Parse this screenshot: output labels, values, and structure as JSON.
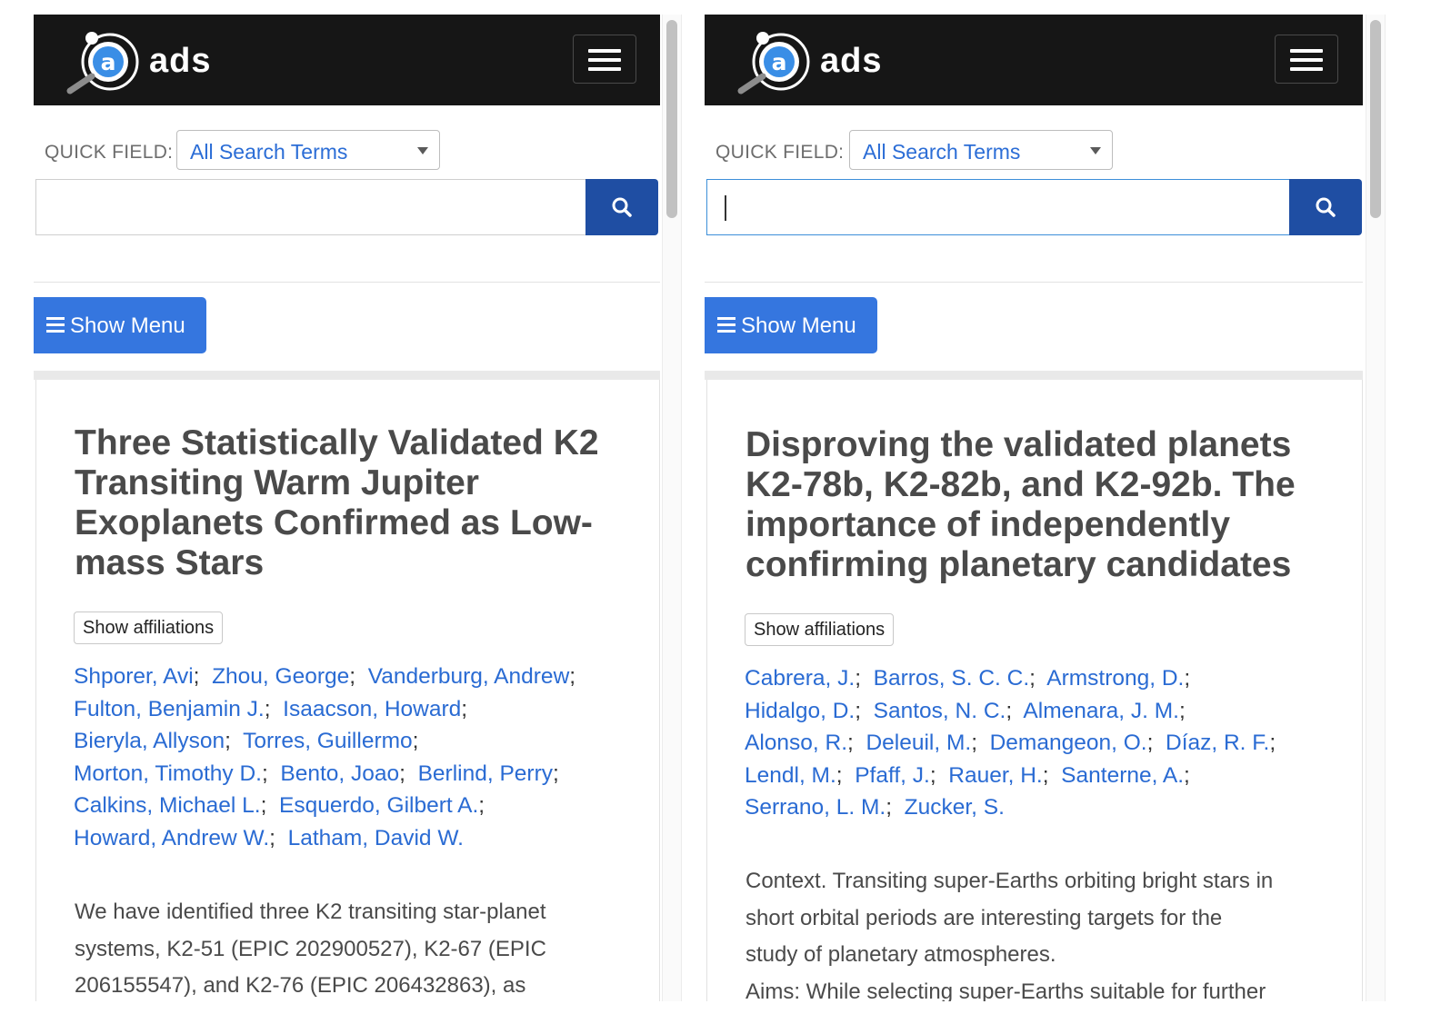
{
  "brand": "ads",
  "colors": {
    "navbar": "#161616",
    "link": "#2a6bd3",
    "primary_button": "#3576df",
    "search_button": "#1f4ea3"
  },
  "left": {
    "quick_field_label": "QUICK FIELD:",
    "quick_field_value": "All Search Terms",
    "search_value": "",
    "show_menu_label": "Show Menu",
    "title": "Three Statistically Validated K2 Transiting Warm Jupiter Exoplanets Confirmed as Low-mass Stars",
    "affiliations_label": "Show affiliations",
    "authors": [
      "Shporer, Avi",
      "Zhou, George",
      "Vanderburg, Andrew",
      "Fulton, Benjamin J.",
      "Isaacson, Howard",
      "Bieryla, Allyson",
      "Torres, Guillermo",
      "Morton, Timothy D.",
      "Bento, Joao",
      "Berlind, Perry",
      "Calkins, Michael L.",
      "Esquerdo, Gilbert A.",
      "Howard, Andrew W.",
      "Latham, David W."
    ],
    "abstract_lines": [
      "We have identified three K2 transiting star-planet",
      "systems, K2-51 (EPIC 202900527), K2-67 (EPIC",
      "206155547), and K2-76 (EPIC 206432863), as"
    ]
  },
  "right": {
    "quick_field_label": "QUICK FIELD:",
    "quick_field_value": "All Search Terms",
    "search_value": "",
    "show_menu_label": "Show Menu",
    "title": "Disproving the validated planets K2-78b, K2-82b, and K2-92b. The importance of independently confirming planetary candidates",
    "affiliations_label": "Show affiliations",
    "authors": [
      "Cabrera, J.",
      "Barros, S. C. C.",
      "Armstrong, D.",
      "Hidalgo, D.",
      "Santos, N. C.",
      "Almenara, J. M.",
      "Alonso, R.",
      "Deleuil, M.",
      "Demangeon, O.",
      "Díaz, R. F.",
      "Lendl, M.",
      "Pfaff, J.",
      "Rauer, H.",
      "Santerne, A.",
      "Serrano, L. M.",
      "Zucker, S."
    ],
    "abstract_lines": [
      "Context. Transiting super-Earths orbiting bright stars in",
      "short orbital periods are interesting targets for the",
      "study of planetary atmospheres.",
      "Aims: While selecting super-Earths suitable for further"
    ]
  }
}
